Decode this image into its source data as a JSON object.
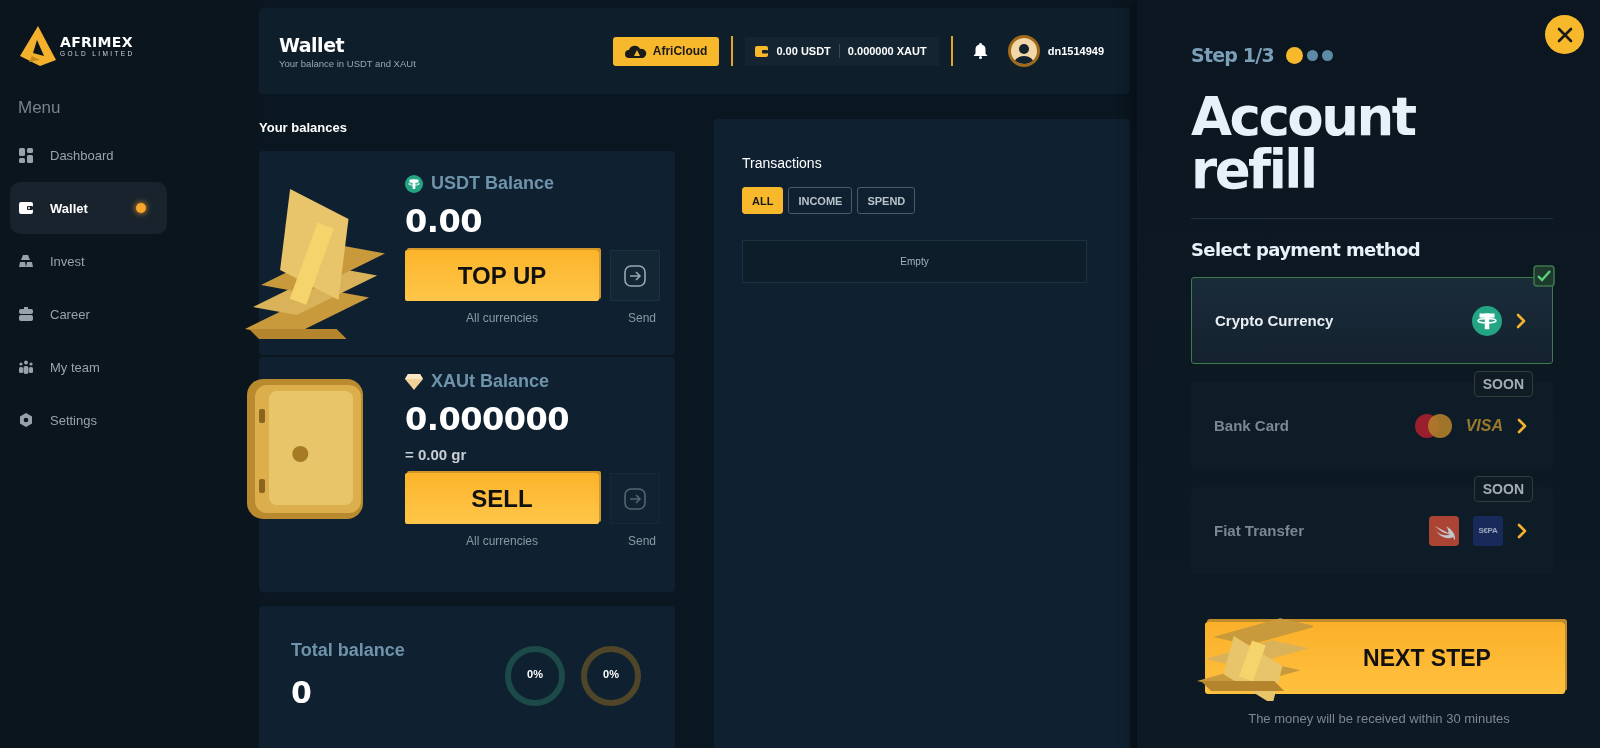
{
  "logo": {
    "name": "AFRIMEX",
    "tagline": "GOLD LIMITED"
  },
  "menu": {
    "title": "Menu",
    "items": [
      {
        "kind": "dashboard",
        "label": "Dashboard",
        "selected": false,
        "dot": false
      },
      {
        "kind": "wallet",
        "label": "Wallet",
        "selected": true,
        "dot": true
      },
      {
        "kind": "invest",
        "label": "Invest",
        "selected": false,
        "dot": false
      },
      {
        "kind": "career",
        "label": "Career",
        "selected": false,
        "dot": false
      },
      {
        "kind": "team",
        "label": "My team",
        "selected": false,
        "dot": false
      },
      {
        "kind": "settings",
        "label": "Settings",
        "selected": false,
        "dot": false
      }
    ]
  },
  "header": {
    "title": "Wallet",
    "subtitle": "Your balance in USDT and XAUt",
    "cloud_button": "AfriCloud",
    "balances": [
      "0.00 USDT",
      "0.000000 XAUT"
    ],
    "username": "dn1514949"
  },
  "balances_title": "Your balances",
  "balance_cards": [
    {
      "kind": "usdt",
      "title": "USDT Balance",
      "amount": "0.00",
      "action": "TOP UP",
      "action_caption": "All currencies",
      "send_caption": "Send"
    },
    {
      "kind": "xaut",
      "title": "XAUt Balance",
      "amount": "0.000000",
      "grams": "= 0.00 gr",
      "action": "SELL",
      "action_caption": "All currencies",
      "send_caption": "Send"
    }
  ],
  "total": {
    "label": "Total balance",
    "amount": "0",
    "rings": [
      {
        "label": "0%",
        "color": "#1c4a48"
      },
      {
        "label": "0%",
        "color": "#4f4528"
      }
    ]
  },
  "transactions": {
    "title": "Transactions",
    "filters": [
      {
        "label": "ALL",
        "selected": true
      },
      {
        "label": "INCOME",
        "selected": false
      },
      {
        "label": "SPEND",
        "selected": false
      }
    ],
    "empty": "Empty"
  },
  "refill": {
    "step": "Step 1/3",
    "steps": [
      {
        "selected": true
      },
      {
        "selected": false
      },
      {
        "selected": false
      }
    ],
    "title": "Account refill",
    "subtitle": "Select payment method",
    "methods": [
      {
        "label": "Crypto Currency",
        "selected": true,
        "disabled": false,
        "logos": [
          {
            "kind": "tether"
          }
        ]
      },
      {
        "label": "Bank Card",
        "selected": false,
        "disabled": true,
        "badge": "SOON",
        "logos": [
          {
            "kind": "mastercard"
          },
          {
            "kind": "wordmark",
            "text": "VISA"
          }
        ]
      },
      {
        "label": "Fiat Transfer",
        "selected": false,
        "disabled": true,
        "badge": "SOON",
        "logos": [
          {
            "kind": "swift"
          },
          {
            "kind": "tile",
            "text": "S€PA"
          }
        ]
      }
    ],
    "next_button": "NEXT STEP",
    "note": "The money will be received within 30 minutes"
  }
}
